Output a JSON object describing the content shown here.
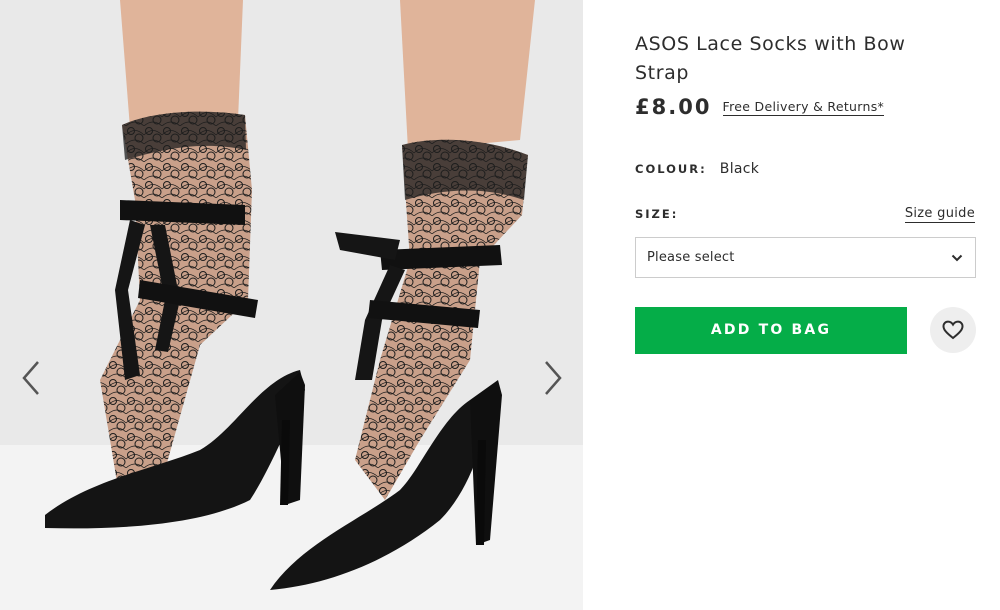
{
  "product": {
    "title": "ASOS Lace Socks with Bow Strap",
    "price": "£8.00",
    "delivery_link": "Free Delivery & Returns*"
  },
  "colour": {
    "label": "COLOUR:",
    "value": "Black"
  },
  "size": {
    "label": "SIZE:",
    "guide_link": "Size guide",
    "selected": "Please select"
  },
  "actions": {
    "add_to_bag": "ADD TO BAG"
  },
  "icons": {
    "prev": "chevron-left-icon",
    "next": "chevron-right-icon",
    "select": "chevron-down-icon",
    "wishlist": "heart-icon"
  },
  "colors": {
    "accent": "#05ad48",
    "text": "#2d2d2d",
    "wishlist_bg": "#eeeeee"
  }
}
